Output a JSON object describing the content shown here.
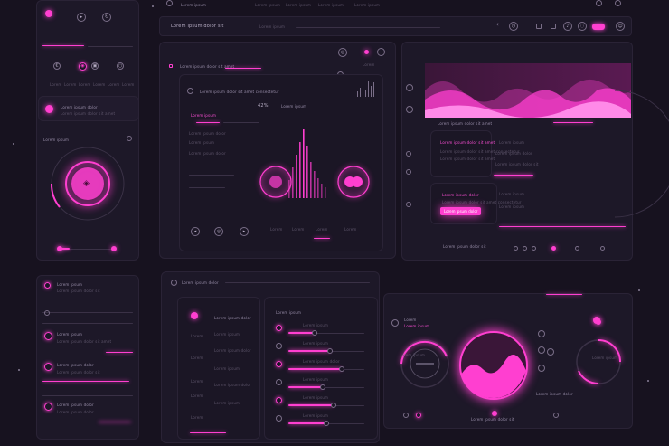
{
  "colors": {
    "accent": "#ff3fd0",
    "background": "#17121f",
    "panel": "#1d1828"
  },
  "topbar": {
    "title": "Lorem ipsum",
    "nav": [
      "Lorem ipsum",
      "Lorem ipsum",
      "Lorem ipsum",
      "Lorem ipsum"
    ],
    "address": "Lorem ipsum dolor sit",
    "address_sub": "Lorem ipsum",
    "toolbar_icons": [
      "back-icon",
      "clock-icon",
      "doc-icon",
      "doc-icon",
      "bell-icon",
      "chat-icon",
      "link-icon",
      "user-icon"
    ]
  },
  "left": {
    "card1_labels": [
      "Lorem",
      "Lorem",
      "Lorem",
      "Lorem",
      "Lorem",
      "Lorem"
    ],
    "profile_name": "Lorem ipsum dolor",
    "profile_sub": "Lorem ipsum dolor sit amet",
    "player_title": "Lorem ipsum",
    "player_icon": "shield-icon",
    "player_progress": 0.2,
    "list_title": "Lorem ipsum",
    "list_sub": "Lorem ipsum dolor sit",
    "list_items": [
      {
        "title": "Lorem ipsum",
        "sub": "Lorem ipsum dolor sit amet"
      },
      {
        "title": "Lorem ipsum dolor",
        "sub": "Lorem ipsum dolor sit"
      },
      {
        "title": "Lorem ipsum dolor",
        "sub": "Lorem ipsum dolor"
      }
    ]
  },
  "analytics": {
    "header": "Lorem ipsum dolor sit amet",
    "title": "Lorem ipsum dolor sit amet consectetur",
    "value": "42%",
    "subtitle": "Lorem ipsum",
    "rows": [
      "Lorem ipsum",
      "Lorem ipsum dolor",
      "Lorem ipsum",
      "Lorem ipsum dolor"
    ],
    "footer_labels": [
      "Lorem",
      "Lorem",
      "Lorem",
      "Lorem"
    ]
  },
  "media": {
    "hero_caption": "Lorem ipsum dolor sit amet",
    "article1_title": "Lorem ipsum dolor sit amet",
    "article1_lines": [
      "Lorem ipsum dolor sit amet consectetur",
      "Lorem ipsum dolor sit amet"
    ],
    "side_lines": [
      "Lorem ipsum",
      "Lorem ipsum dolor",
      "Lorem ipsum dolor sit",
      "Lorem ipsum"
    ],
    "article2_title": "Lorem ipsum dolor",
    "article2_lines": [
      "Lorem ipsum dolor sit amet consectetur",
      "Lorem ipsum dolor"
    ],
    "cta": "Lorem ipsum dolor",
    "footer": "Lorem ipsum dolor sit"
  },
  "settings": {
    "header": "Lorem ipsum dolor",
    "list": [
      "Lorem ipsum dolor",
      "Lorem ipsum",
      "Lorem ipsum dolor",
      "Lorem ipsum",
      "Lorem",
      "Lorem ipsum dolor",
      "Lorem ipsum"
    ],
    "sliders_title": "Lorem ipsum",
    "sliders": [
      {
        "label": "Lorem ipsum",
        "value": 0.35
      },
      {
        "label": "Lorem ipsum",
        "value": 0.55
      },
      {
        "label": "Lorem ipsum dolor",
        "value": 0.7
      },
      {
        "label": "Lorem ipsum",
        "value": 0.45
      },
      {
        "label": "Lorem ipsum",
        "value": 0.6
      },
      {
        "label": "Lorem ipsum",
        "value": 0.5
      }
    ]
  },
  "dashboard": {
    "title": "Lorem",
    "sub": "Lorem ipsum",
    "gauge_left": "Lorem ipsum",
    "gauge_right": "Lorem ipsum",
    "label_right": "Lorem ipsum dolor",
    "footer": "Lorem ipsum dolor sit"
  }
}
